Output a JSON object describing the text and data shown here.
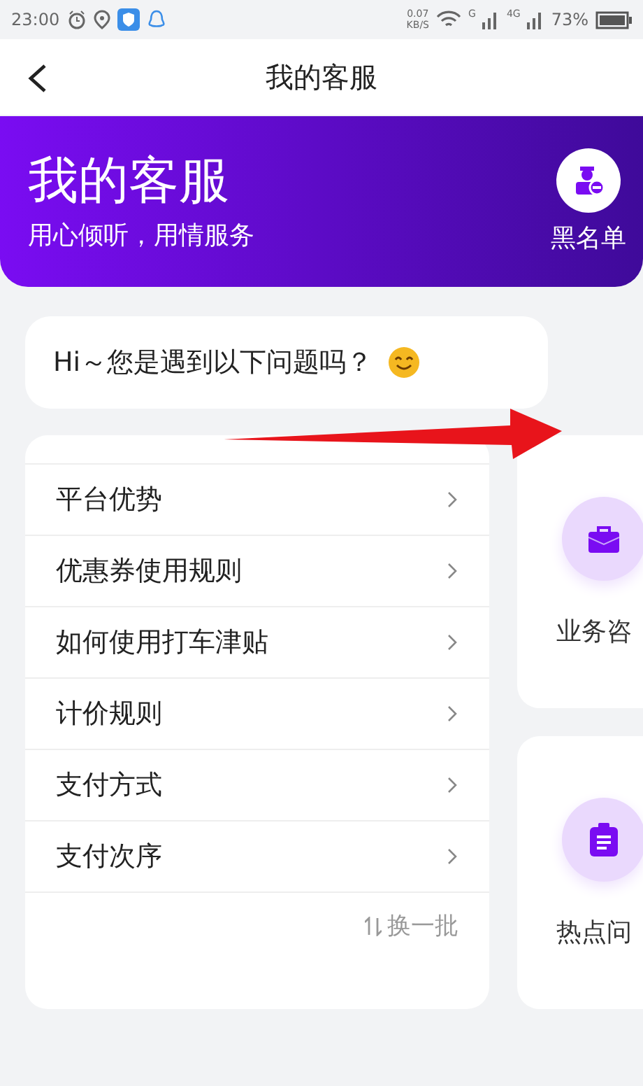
{
  "status_bar": {
    "time": "23:00",
    "speed": "0.07",
    "speed_unit": "KB/S",
    "sim1": "G",
    "sim2": "4G",
    "battery": "73%"
  },
  "nav": {
    "title": "我的客服"
  },
  "banner": {
    "title": "我的客服",
    "subtitle": "用心倾听，用情服务",
    "action": "黑名单"
  },
  "greeting": "Hi～您是遇到以下问题吗？",
  "faq": {
    "items": [
      "平台优势",
      "优惠券使用规则",
      "如何使用打车津贴",
      "计价规则",
      "支付方式",
      "支付次序"
    ],
    "refresh": "换一批"
  },
  "services": [
    {
      "kind": "briefcase",
      "label": "业务咨"
    },
    {
      "kind": "clipboard",
      "label": "热点问"
    }
  ]
}
